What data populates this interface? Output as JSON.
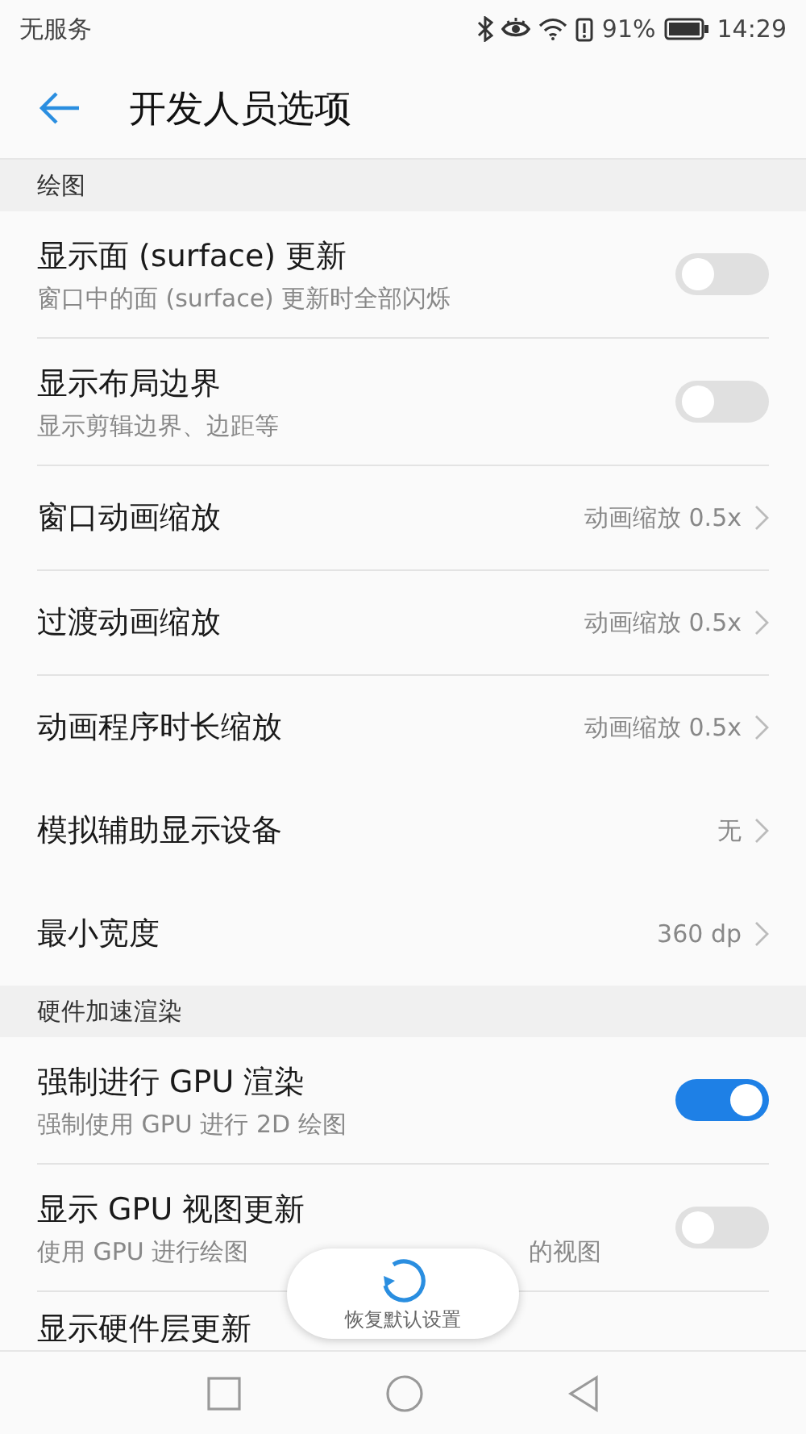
{
  "status_bar": {
    "carrier": "无服务",
    "battery_percent": "91%",
    "time": "14:29"
  },
  "app_bar": {
    "title": "开发人员选项"
  },
  "sections": [
    {
      "header": "绘图",
      "items": [
        {
          "kind": "switch",
          "title": "显示面 (surface) 更新",
          "summary": [
            "窗口中的面 (surface) 更新时全部闪烁"
          ],
          "on": false
        },
        {
          "kind": "switch",
          "title": "显示布局边界",
          "summary": [
            "显示剪辑边界、边距等"
          ],
          "on": false
        },
        {
          "kind": "value",
          "title": "窗口动画缩放",
          "value": "动画缩放 0.5x"
        },
        {
          "kind": "value",
          "title": "过渡动画缩放",
          "value": "动画缩放 0.5x"
        },
        {
          "kind": "value",
          "title": "动画程序时长缩放",
          "value": "动画缩放 0.5x"
        },
        {
          "kind": "value",
          "title": "模拟辅助显示设备",
          "value": "无"
        },
        {
          "kind": "value",
          "title": "最小宽度",
          "value": "360 dp"
        }
      ]
    },
    {
      "header": "硬件加速渲染",
      "items": [
        {
          "kind": "switch",
          "title": "强制进行 GPU 渲染",
          "summary": [
            "强制使用 GPU 进行 2D 绘图"
          ],
          "on": true
        },
        {
          "kind": "switch",
          "title": "显示 GPU 视图更新",
          "summary": [
            "使用 GPU 进行绘图",
            "的视图"
          ],
          "on": false
        },
        {
          "kind": "cut",
          "title": "显示硬件层更新"
        }
      ]
    }
  ],
  "toast": {
    "label": "恢复默认设置"
  }
}
